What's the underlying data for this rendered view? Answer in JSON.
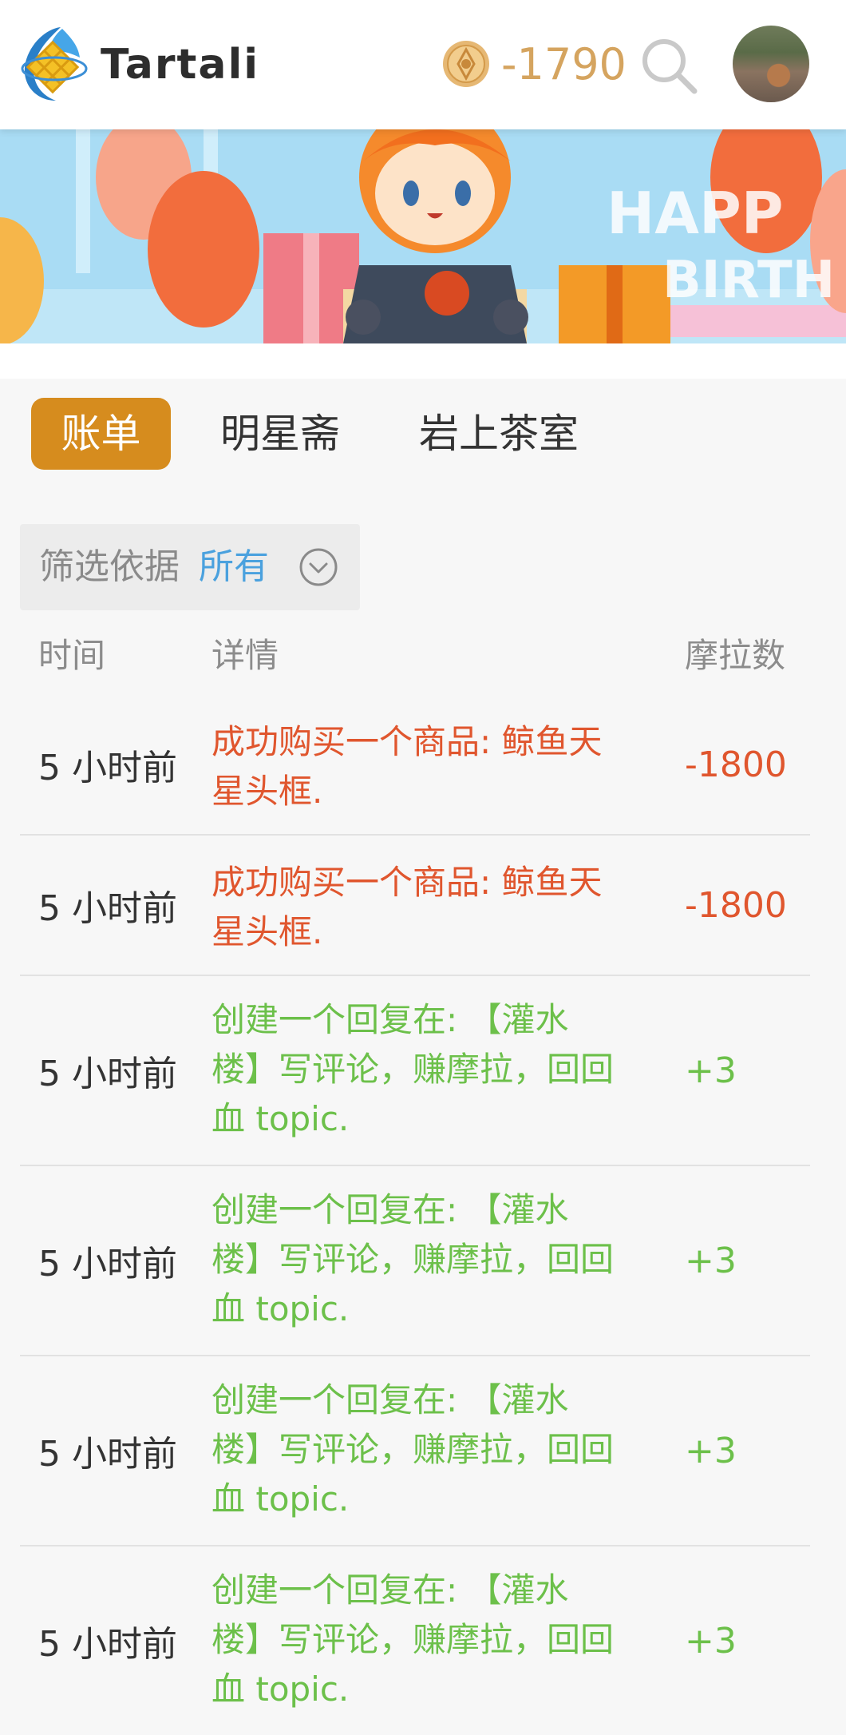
{
  "header": {
    "brand": "Tartali",
    "balance": "-1790",
    "icons": {
      "logo": "tartali-logo-icon",
      "coin": "mora-coin-icon",
      "search": "search-icon",
      "avatar": "user-avatar"
    }
  },
  "tabs": [
    {
      "label": "账单",
      "active": true
    },
    {
      "label": "明星斋",
      "active": false
    },
    {
      "label": "岩上茶室",
      "active": false
    }
  ],
  "filter": {
    "label": "筛选依据",
    "value": "所有"
  },
  "table": {
    "headers": {
      "time": "时间",
      "detail": "详情",
      "amount": "摩拉数"
    },
    "rows": [
      {
        "time": "5 小时前",
        "detail_l1": "成功购买一个商品: 鲸鱼天",
        "detail_l2": "星头框.",
        "detail_l3": "",
        "amount": "-1800",
        "kind": "neg"
      },
      {
        "time": "5 小时前",
        "detail_l1": "成功购买一个商品: 鲸鱼天",
        "detail_l2": "星头框.",
        "detail_l3": "",
        "amount": "-1800",
        "kind": "neg"
      },
      {
        "time": "5 小时前",
        "detail_l1": "创建一个回复在: 【灌水",
        "detail_l2": "楼】写评论，赚摩拉，回回",
        "detail_l3": "血 topic.",
        "amount": "+3",
        "kind": "pos"
      },
      {
        "time": "5 小时前",
        "detail_l1": "创建一个回复在: 【灌水",
        "detail_l2": "楼】写评论，赚摩拉，回回",
        "detail_l3": "血 topic.",
        "amount": "+3",
        "kind": "pos"
      },
      {
        "time": "5 小时前",
        "detail_l1": "创建一个回复在: 【灌水",
        "detail_l2": "楼】写评论，赚摩拉，回回",
        "detail_l3": "血 topic.",
        "amount": "+3",
        "kind": "pos"
      },
      {
        "time": "5 小时前",
        "detail_l1": "创建一个回复在: 【灌水",
        "detail_l2": "楼】写评论，赚摩拉，回回",
        "detail_l3": "血 topic.",
        "amount": "+3",
        "kind": "pos"
      }
    ]
  },
  "colors": {
    "accent": "#d68c1e",
    "negative": "#e0562e",
    "positive": "#6cc04a",
    "link": "#4aa1de",
    "coin": "#d5a45f"
  }
}
